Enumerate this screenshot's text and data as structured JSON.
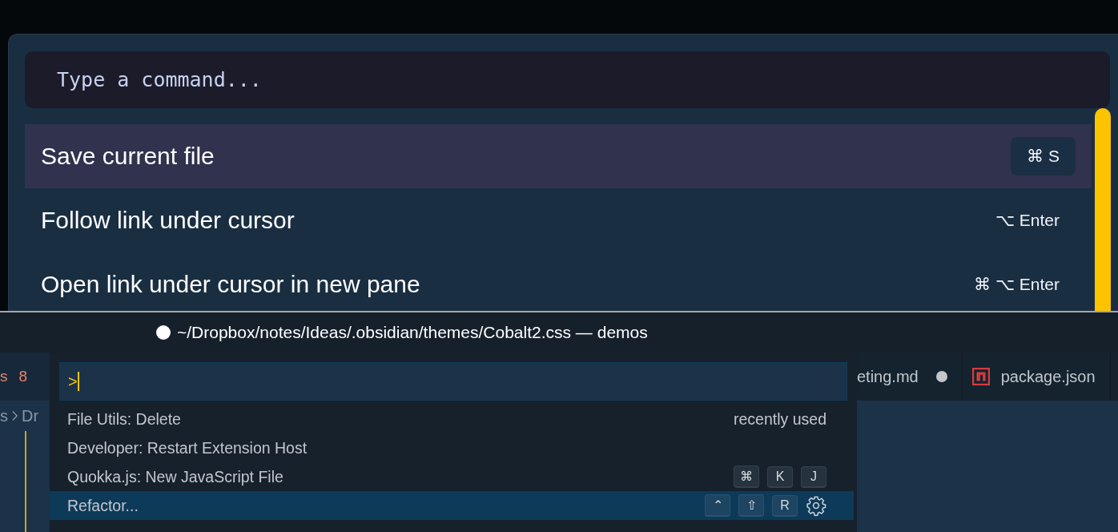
{
  "obsidian_palette": {
    "placeholder": "Type a command...",
    "commands": [
      {
        "label": "Save current file",
        "hotkey": "⌘ S",
        "selected": true
      },
      {
        "label": "Follow link under cursor",
        "hotkey": "⌥ Enter",
        "selected": false
      },
      {
        "label": "Open link under cursor in new pane",
        "hotkey": "⌘ ⌥ Enter",
        "selected": false
      }
    ]
  },
  "vscode": {
    "title": "~/Dropbox/notes/Ideas/.obsidian/themes/Cobalt2.css — demos",
    "dirty": true,
    "left_tab": {
      "label": "s",
      "count": "8"
    },
    "breadcrumb": [
      "s",
      "Dr"
    ],
    "tabs": [
      {
        "label": "eting.md",
        "dirty": true,
        "kind": "plain"
      },
      {
        "label": "package.json",
        "dirty": false,
        "kind": "npm"
      }
    ],
    "quick_open": {
      "value": ">",
      "items": [
        {
          "label": "File Utils: Delete",
          "detail": "recently used",
          "settings": false,
          "selected": false
        },
        {
          "label": "Developer: Restart Extension Host",
          "settings": false,
          "selected": false
        },
        {
          "label": "Quokka.js: New JavaScript File",
          "keys": [
            "⌘",
            "K",
            "J"
          ],
          "settings": false,
          "selected": false
        },
        {
          "label": "Refactor...",
          "keys": [
            "⌃",
            "⇧",
            "R"
          ],
          "settings": true,
          "selected": true
        }
      ]
    }
  }
}
